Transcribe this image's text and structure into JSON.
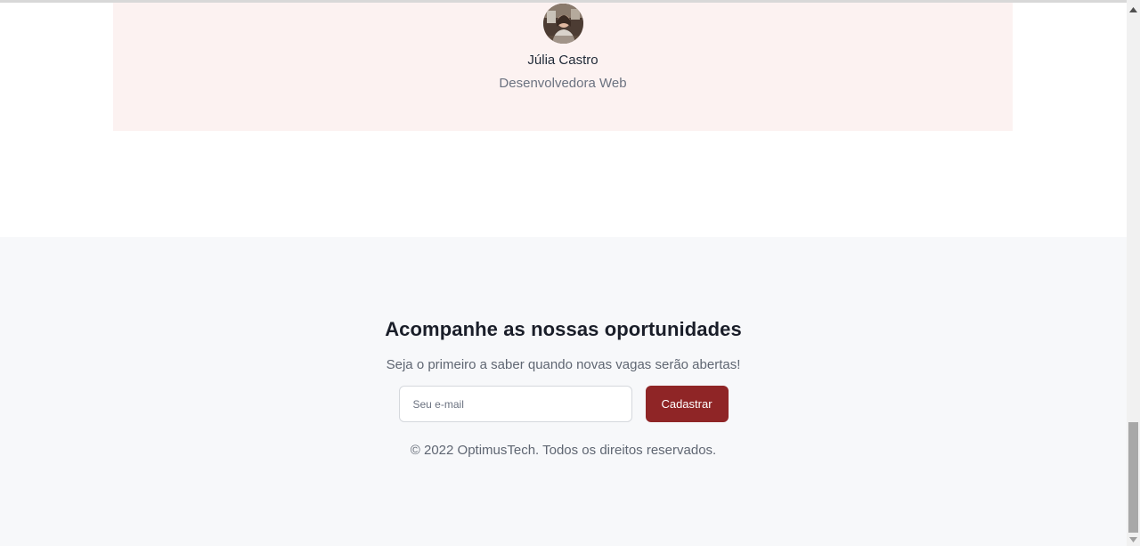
{
  "testimonial": {
    "name": "Júlia Castro",
    "role": "Desenvolvedora Web"
  },
  "newsletter": {
    "title": "Acompanhe as nossas oportunidades",
    "subtitle": "Seja o primeiro a saber quando novas vagas serão abertas!",
    "email_placeholder": "Seu e-mail",
    "submit_label": "Cadastrar",
    "copyright": "© 2022 OptimusTech. Todos os direitos reservados."
  },
  "colors": {
    "card_background": "#fcf2f1",
    "footer_background": "#f7f8fa",
    "button_accent": "#8f2526"
  },
  "icons": {
    "scroll_up": "triangle-up-icon",
    "scroll_down": "triangle-down-icon"
  },
  "scrollbar": {
    "position_fraction": 0.82
  }
}
